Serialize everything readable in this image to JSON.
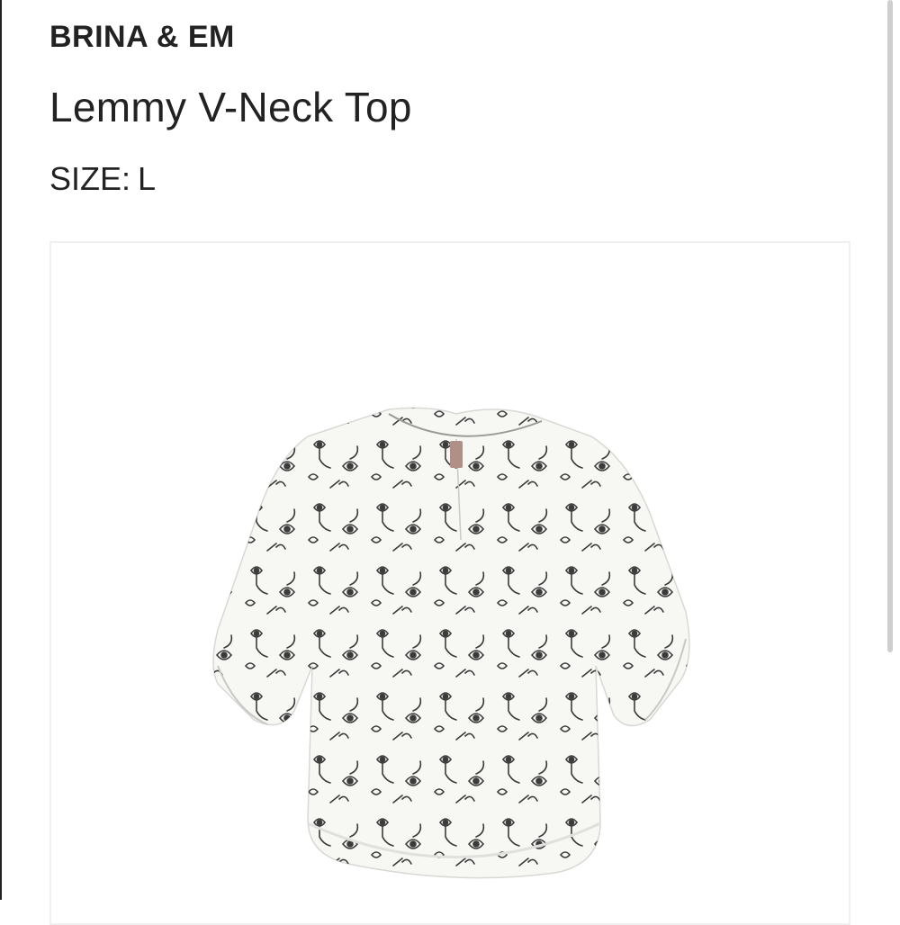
{
  "product": {
    "brand": "BRINA & EM",
    "name": "Lemmy V-Neck Top",
    "size_label": "SIZE:",
    "size_value": "L"
  },
  "image": {
    "icon": "floral-blouse-image",
    "garment_color": "#f7f7f4",
    "print_color": "#1a1a1a",
    "tag_color": "#b08f86"
  }
}
